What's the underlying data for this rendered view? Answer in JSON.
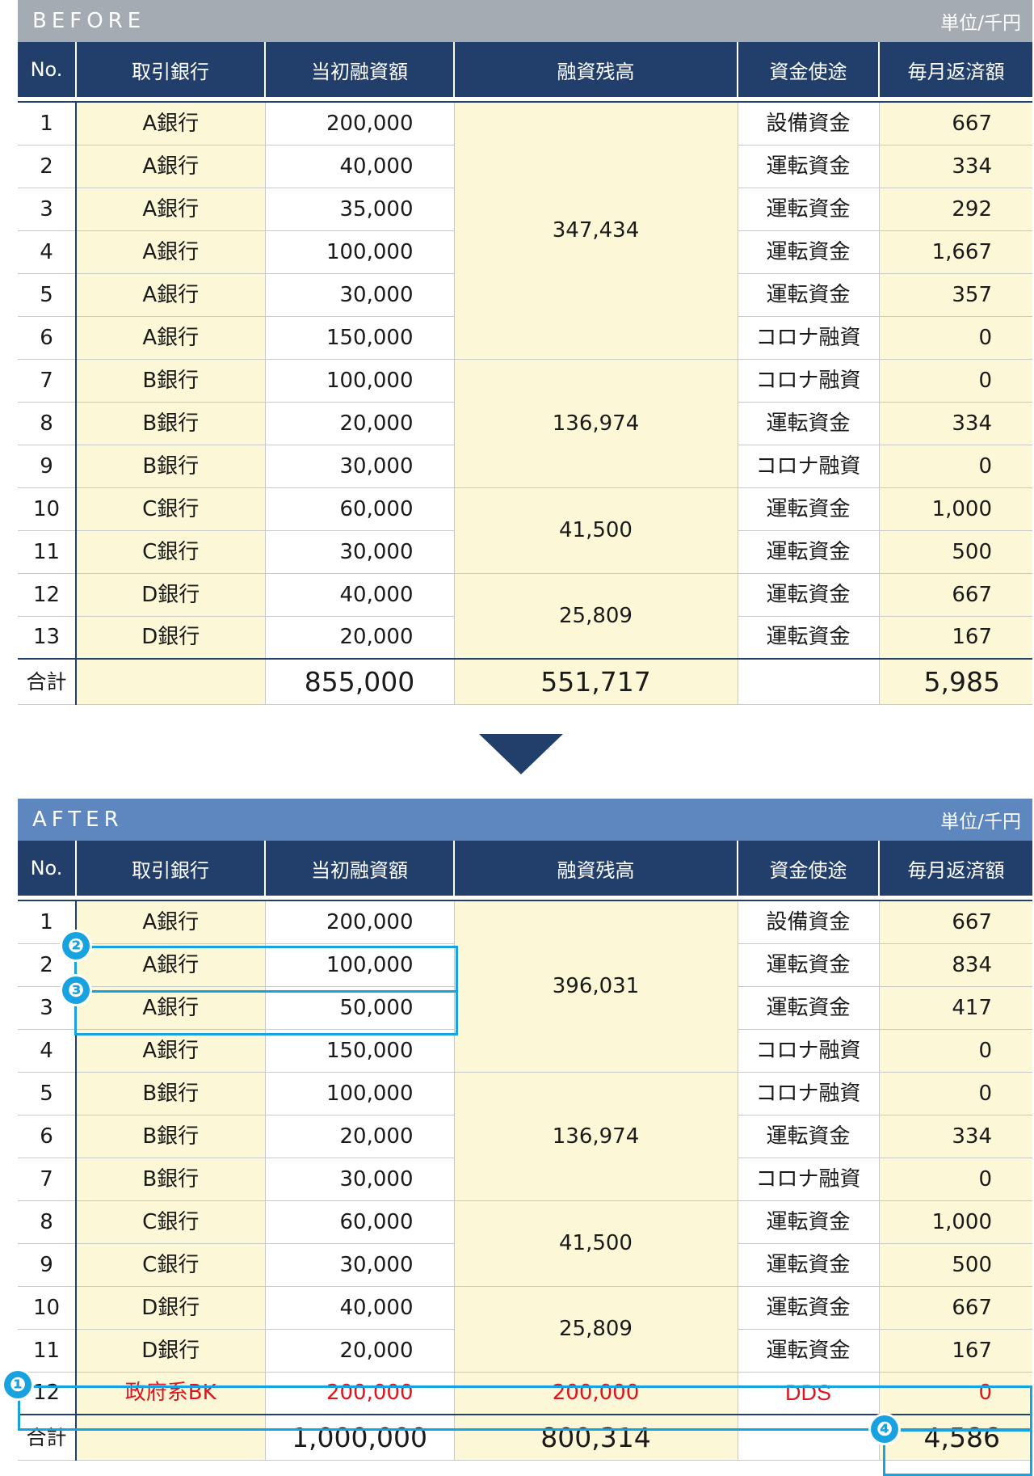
{
  "headers": [
    "No.",
    "取引銀行",
    "当初融資額",
    "融資残高",
    "資金使途",
    "毎月返済額"
  ],
  "before": {
    "label": "BEFORE",
    "unit": "単位/千円",
    "rows": [
      {
        "no": "1",
        "bank": "A銀行",
        "amount": "200,000",
        "use": "設備資金",
        "monthly": "667"
      },
      {
        "no": "2",
        "bank": "A銀行",
        "amount": "40,000",
        "use": "運転資金",
        "monthly": "334"
      },
      {
        "no": "3",
        "bank": "A銀行",
        "amount": "35,000",
        "use": "運転資金",
        "monthly": "292"
      },
      {
        "no": "4",
        "bank": "A銀行",
        "amount": "100,000",
        "use": "運転資金",
        "monthly": "1,667"
      },
      {
        "no": "5",
        "bank": "A銀行",
        "amount": "30,000",
        "use": "運転資金",
        "monthly": "357"
      },
      {
        "no": "6",
        "bank": "A銀行",
        "amount": "150,000",
        "use": "コロナ融資",
        "monthly": "0"
      },
      {
        "no": "7",
        "bank": "B銀行",
        "amount": "100,000",
        "use": "コロナ融資",
        "monthly": "0"
      },
      {
        "no": "8",
        "bank": "B銀行",
        "amount": "20,000",
        "use": "運転資金",
        "monthly": "334"
      },
      {
        "no": "9",
        "bank": "B銀行",
        "amount": "30,000",
        "use": "コロナ融資",
        "monthly": "0"
      },
      {
        "no": "10",
        "bank": "C銀行",
        "amount": "60,000",
        "use": "運転資金",
        "monthly": "1,000"
      },
      {
        "no": "11",
        "bank": "C銀行",
        "amount": "30,000",
        "use": "運転資金",
        "monthly": "500"
      },
      {
        "no": "12",
        "bank": "D銀行",
        "amount": "40,000",
        "use": "運転資金",
        "monthly": "667"
      },
      {
        "no": "13",
        "bank": "D銀行",
        "amount": "20,000",
        "use": "運転資金",
        "monthly": "167"
      }
    ],
    "balances": [
      {
        "value": "347,434",
        "span": 6
      },
      {
        "value": "136,974",
        "span": 3
      },
      {
        "value": "41,500",
        "span": 2
      },
      {
        "value": "25,809",
        "span": 2
      }
    ],
    "total": {
      "label": "合計",
      "amount": "855,000",
      "balance": "551,717",
      "monthly": "5,985"
    }
  },
  "after": {
    "label": "AFTER",
    "unit": "単位/千円",
    "rows": [
      {
        "no": "1",
        "bank": "A銀行",
        "amount": "200,000",
        "use": "設備資金",
        "monthly": "667"
      },
      {
        "no": "2",
        "bank": "A銀行",
        "amount": "100,000",
        "use": "運転資金",
        "monthly": "834"
      },
      {
        "no": "3",
        "bank": "A銀行",
        "amount": "50,000",
        "use": "運転資金",
        "monthly": "417"
      },
      {
        "no": "4",
        "bank": "A銀行",
        "amount": "150,000",
        "use": "コロナ融資",
        "monthly": "0"
      },
      {
        "no": "5",
        "bank": "B銀行",
        "amount": "100,000",
        "use": "コロナ融資",
        "monthly": "0"
      },
      {
        "no": "6",
        "bank": "B銀行",
        "amount": "20,000",
        "use": "運転資金",
        "monthly": "334"
      },
      {
        "no": "7",
        "bank": "B銀行",
        "amount": "30,000",
        "use": "コロナ融資",
        "monthly": "0"
      },
      {
        "no": "8",
        "bank": "C銀行",
        "amount": "60,000",
        "use": "運転資金",
        "monthly": "1,000"
      },
      {
        "no": "9",
        "bank": "C銀行",
        "amount": "30,000",
        "use": "運転資金",
        "monthly": "500"
      },
      {
        "no": "10",
        "bank": "D銀行",
        "amount": "40,000",
        "use": "運転資金",
        "monthly": "667"
      },
      {
        "no": "11",
        "bank": "D銀行",
        "amount": "20,000",
        "use": "運転資金",
        "monthly": "167"
      },
      {
        "no": "12",
        "bank": "政府系BK",
        "amount": "200,000",
        "use": "DDS",
        "monthly": "0",
        "balance": "200,000",
        "highlight": true
      }
    ],
    "balances": [
      {
        "value": "396,031",
        "span": 4
      },
      {
        "value": "136,974",
        "span": 3
      },
      {
        "value": "41,500",
        "span": 2
      },
      {
        "value": "25,809",
        "span": 2
      },
      {
        "value": "200,000",
        "span": 1
      }
    ],
    "total": {
      "label": "合計",
      "amount": "1,000,000",
      "balance": "800,314",
      "monthly": "4,586"
    }
  },
  "badges": [
    "❶",
    "❷",
    "❸",
    "❹"
  ],
  "colors": {
    "header": "#223f6b",
    "highlight_box": "#19a2e0",
    "cell_yellow": "#fcf7d6",
    "red_text": "#e0141e",
    "before_bar": "#a5abb3",
    "after_bar": "#5e87bf"
  }
}
